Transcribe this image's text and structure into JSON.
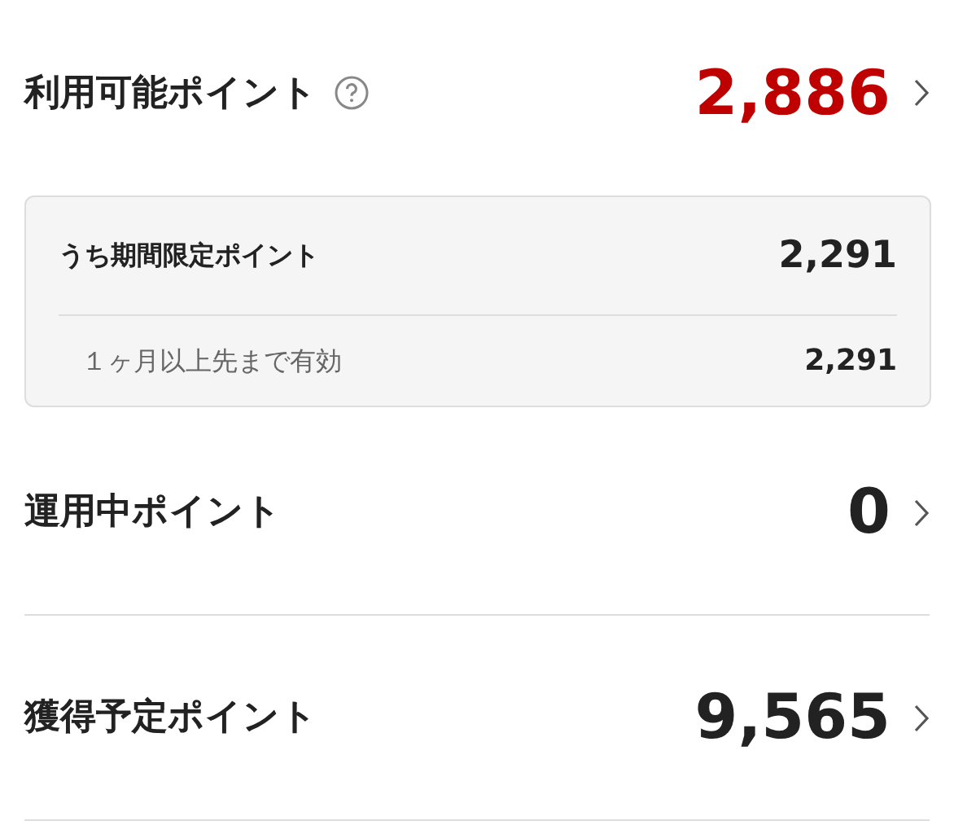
{
  "available": {
    "label": "利用可能ポイント",
    "value": "2,886",
    "has_help": true
  },
  "limited": {
    "label": "うち期間限定ポイント",
    "value": "2,291",
    "breakdown": [
      {
        "label": "１ヶ月以上先まで有効",
        "value": "2,291"
      }
    ]
  },
  "balances": [
    {
      "label": "運用中ポイント",
      "value": "0"
    },
    {
      "label": "獲得予定ポイント",
      "value": "9,565"
    }
  ]
}
